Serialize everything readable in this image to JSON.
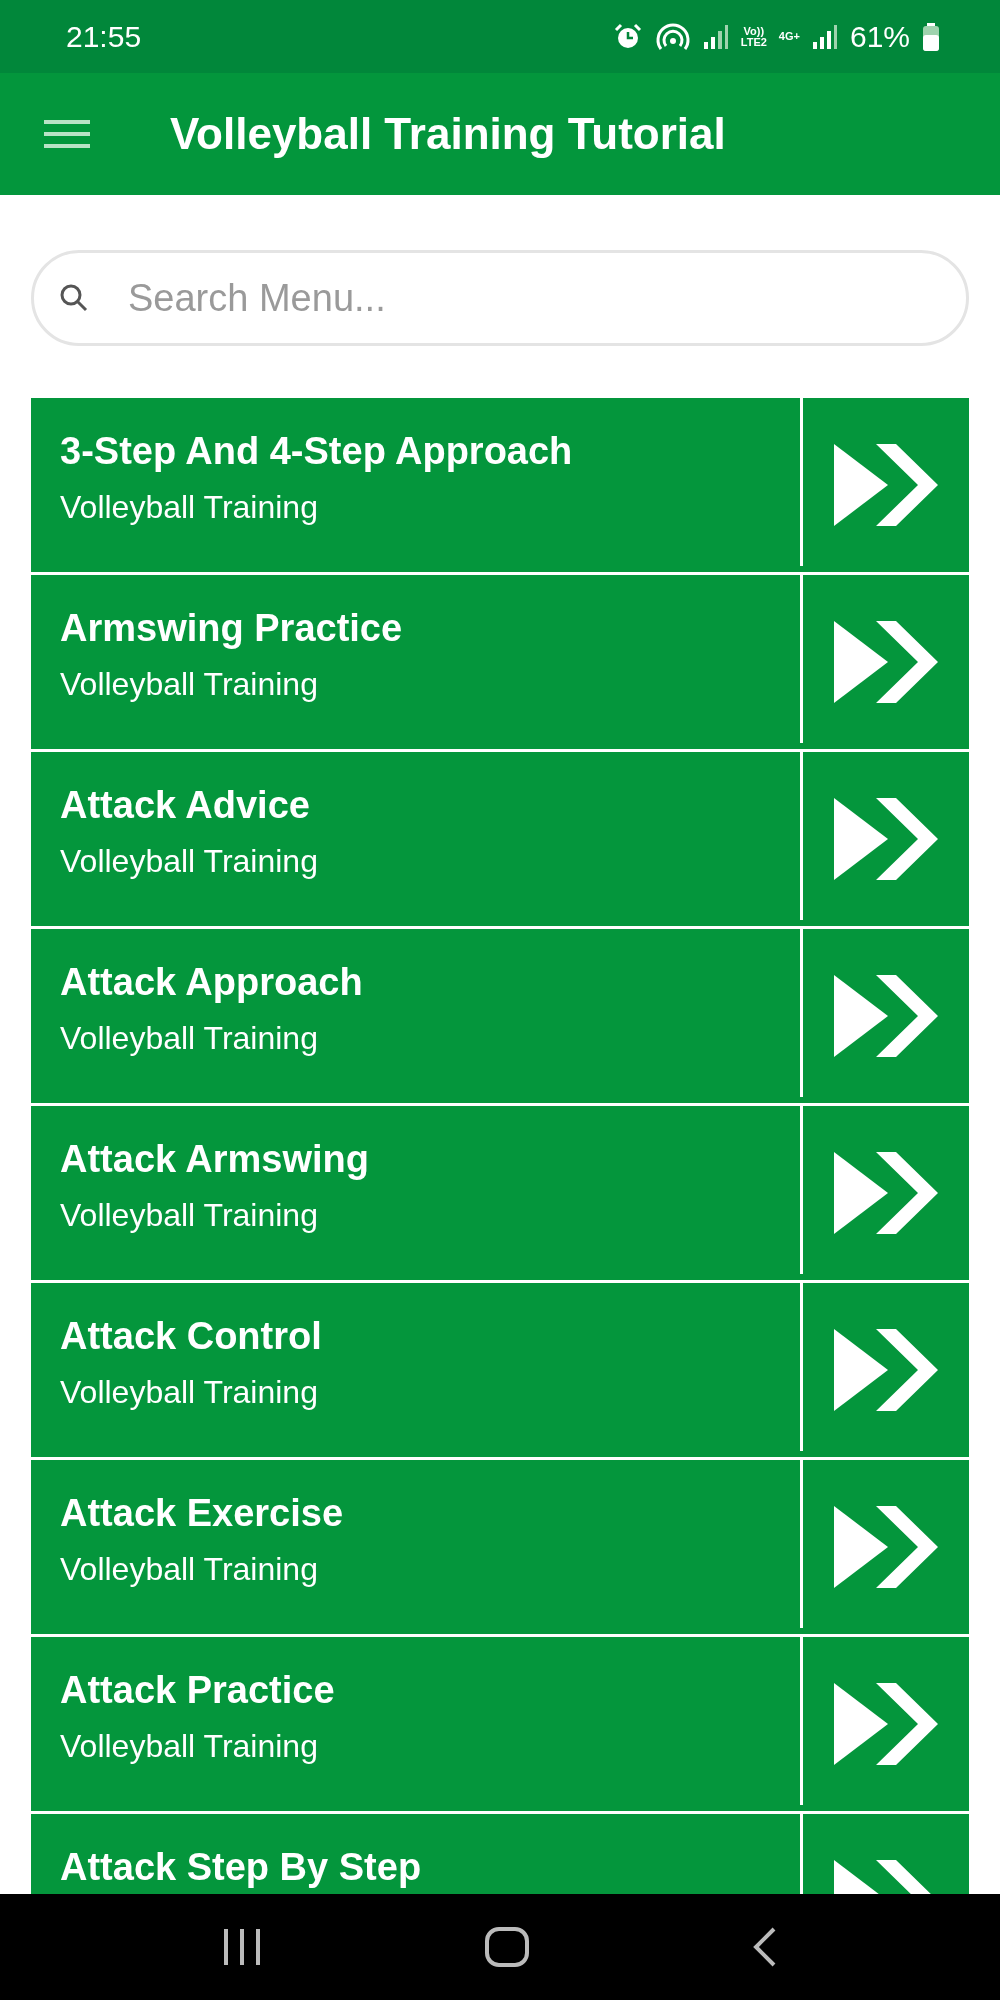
{
  "status_bar": {
    "time": "21:55",
    "volte_top": "Vo))",
    "volte_bottom": "LTE2",
    "network": "4G+",
    "battery": "61%"
  },
  "app_bar": {
    "title": "Volleyball Training Tutorial"
  },
  "search": {
    "placeholder": "Search Menu..."
  },
  "items": [
    {
      "title": "3-Step And 4-Step Approach",
      "subtitle": "Volleyball Training"
    },
    {
      "title": "Armswing Practice",
      "subtitle": "Volleyball Training"
    },
    {
      "title": "Attack Advice",
      "subtitle": "Volleyball Training"
    },
    {
      "title": "Attack Approach",
      "subtitle": "Volleyball Training"
    },
    {
      "title": "Attack Armswing",
      "subtitle": "Volleyball Training"
    },
    {
      "title": "Attack Control",
      "subtitle": "Volleyball Training"
    },
    {
      "title": "Attack Exercise",
      "subtitle": "Volleyball Training"
    },
    {
      "title": "Attack Practice",
      "subtitle": "Volleyball Training"
    },
    {
      "title": "Attack Step By Step"
    }
  ]
}
